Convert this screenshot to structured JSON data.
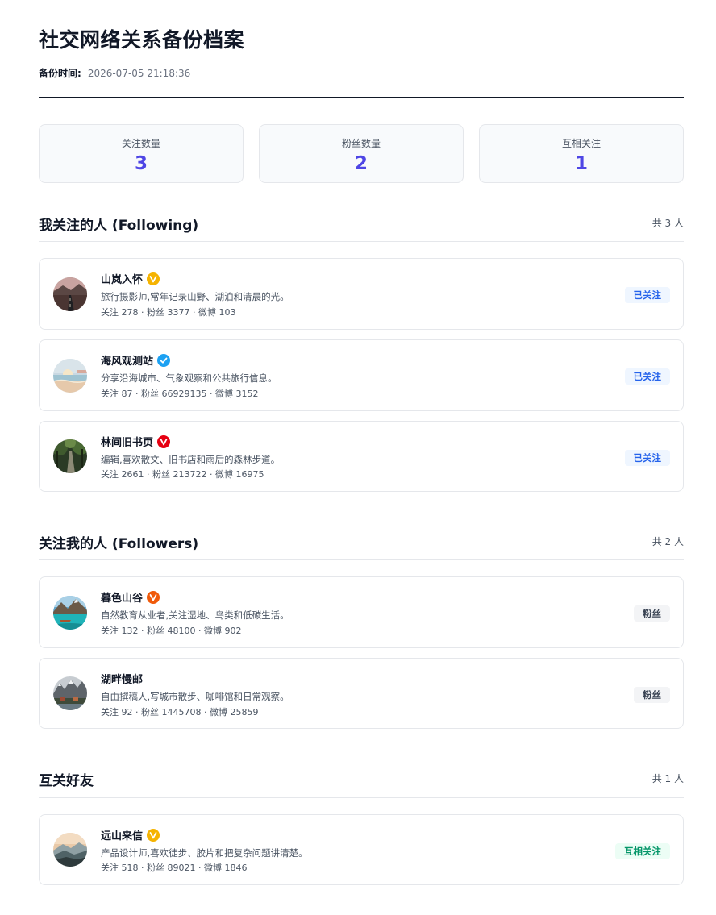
{
  "header": {
    "title": "社交网络关系备份档案",
    "backup_label": "备份时间:",
    "backup_time": "2026-07-05 21:18:36"
  },
  "stats": [
    {
      "label": "关注数量",
      "value": "3"
    },
    {
      "label": "粉丝数量",
      "value": "2"
    },
    {
      "label": "互相关注",
      "value": "1"
    }
  ],
  "sections": [
    {
      "title": "我关注的人 (Following)",
      "count": "共 3 人",
      "users": [
        {
          "name": "山岚入怀",
          "badge": "yellow-v-badge-icon",
          "bio": "旅行摄影师,常年记录山野、湖泊和清晨的光。",
          "stats": "关注 278 · 粉丝 3377 · 微博 103",
          "tag": "已关注",
          "avatar": "road-landscape-avatar"
        },
        {
          "name": "海风观测站",
          "badge": "blue-v-badge-icon",
          "bio": "分享沿海城市、气象观察和公共旅行信息。",
          "stats": "关注 87 · 粉丝 66929135 · 微博 3152",
          "tag": "已关注",
          "avatar": "beach-sunset-avatar"
        },
        {
          "name": "林间旧书页",
          "badge": "red-v-badge-icon",
          "bio": "编辑,喜欢散文、旧书店和雨后的森林步道。",
          "stats": "关注 2661 · 粉丝 213722 · 微博 16975",
          "tag": "已关注",
          "avatar": "forest-path-avatar"
        }
      ]
    },
    {
      "title": "关注我的人 (Followers)",
      "count": "共 2 人",
      "users": [
        {
          "name": "暮色山谷",
          "badge": "orange-v-badge-icon",
          "bio": "自然教育从业者,关注湿地、鸟类和低碳生活。",
          "stats": "关注 132 · 粉丝 48100 · 微博 902",
          "tag": "粉丝",
          "avatar": "lake-mountain-avatar"
        },
        {
          "name": "湖畔慢邮",
          "badge": "",
          "bio": "自由撰稿人,写城市散步、咖啡馆和日常观察。",
          "stats": "关注 92 · 粉丝 1445708 · 微博 25859",
          "tag": "粉丝",
          "avatar": "alpine-village-avatar"
        }
      ]
    },
    {
      "title": "互关好友",
      "count": "共 1 人",
      "users": [
        {
          "name": "远山来信",
          "badge": "yellow-v-badge-icon",
          "bio": "产品设计师,喜欢徒步、胶片和把复杂问题讲清楚。",
          "stats": "关注 518 · 粉丝 89021 · 微博 1846",
          "tag": "互相关注",
          "avatar": "misty-mountain-avatar"
        }
      ]
    }
  ],
  "colors": {
    "accent": "#4f46e5",
    "following_tag": "#2563eb",
    "mutual_tag": "#059669",
    "badge_yellow": "#f5b301",
    "badge_blue": "#1da1f2",
    "badge_red": "#e60012",
    "badge_orange": "#f05a0a"
  }
}
